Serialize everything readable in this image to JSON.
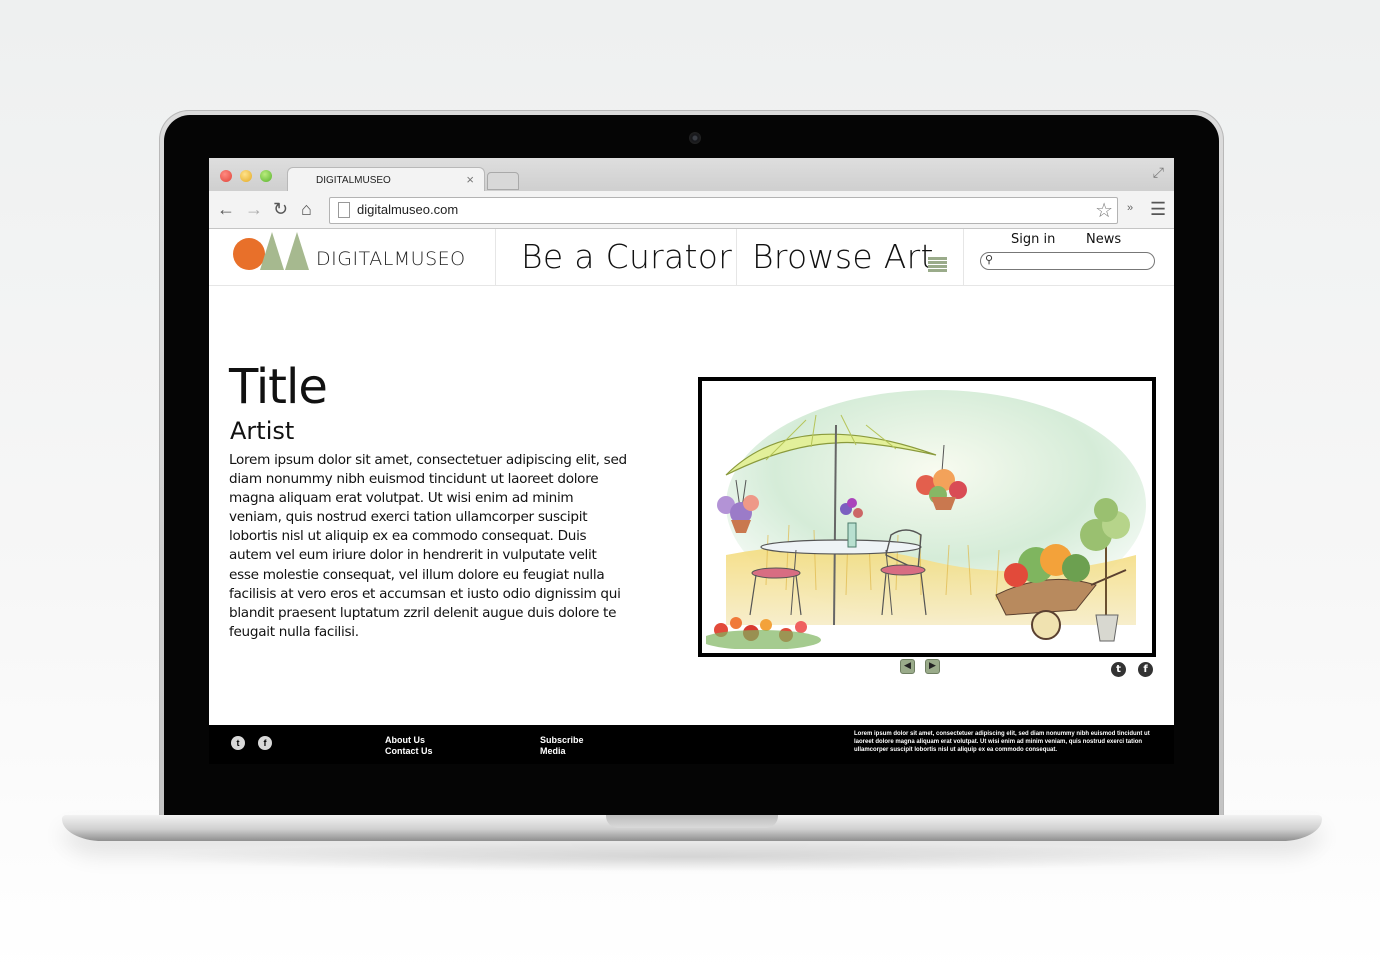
{
  "browser": {
    "tab_title": "DIGITALMUSEO",
    "url": "digitalmuseo.com"
  },
  "site": {
    "logo_text": "DIGITALMUSEO",
    "nav": [
      "Be a Curator",
      "Browse Art"
    ],
    "sign_in": "Sign in",
    "news": "News",
    "search_placeholder": ""
  },
  "artwork": {
    "title": "Title",
    "artist": "Artist",
    "description": "Lorem ipsum dolor sit amet, consectetuer adipiscing elit, sed diam nonummy nibh euismod tincidunt ut laoreet dolore magna aliquam erat volutpat. Ut wisi enim ad minim veniam, quis nostrud exerci tation ullamcorper suscipit lobortis nisl ut aliquip ex ea commodo consequat. Duis autem vel eum iriure dolor in hendrerit in vulputate velit esse molestie consequat, vel illum dolore eu feugiat nulla facilisis at vero eros et accumsan et iusto odio dignissim qui blandit praesent luptatum zzril delenit augue duis dolore te feugait nulla facilisi."
  },
  "footer": {
    "links_col1": [
      "About Us",
      "Contact Us"
    ],
    "links_col2": [
      "Subscribe",
      "Media"
    ],
    "text": "Lorem ipsum dolor sit amet, consectetuer adipiscing elit, sed diam nonummy nibh euismod tincidunt ut laoreet dolore magna aliquam erat volutpat. Ut wisi enim ad minim veniam, quis nostrud exerci tation ullamcorper suscipit lobortis nisl ut aliquip ex ea commodo consequat."
  },
  "icons": {
    "twitter": "twitter-icon",
    "facebook": "facebook-icon",
    "prev": "arrow-left-icon",
    "next": "arrow-right-icon"
  },
  "colors": {
    "logo_orange": "#e8702a",
    "logo_green": "#a6b98f",
    "accent_green": "#9aab8a"
  }
}
